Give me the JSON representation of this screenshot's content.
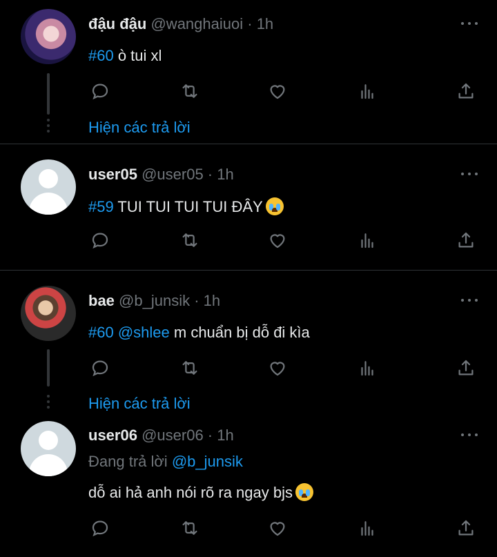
{
  "tweets": [
    {
      "name": "đậu đậu",
      "handle": "@wanghaiuoi",
      "time": "1h",
      "tag": "#60",
      "text": " ò tui xl",
      "show_replies": "Hiện các trả lời"
    },
    {
      "name": "user05",
      "handle": "@user05",
      "time": "1h",
      "tag": "#59",
      "text": " TUI TUI TUI TUI ĐÂY"
    },
    {
      "name": "bae",
      "handle": "@b_junsik",
      "time": "1h",
      "tag": "#60",
      "mention": " @shlee",
      "text": " m chuẩn bị dỗ đi kìa",
      "show_replies": "Hiện các trả lời"
    },
    {
      "name": "user06",
      "handle": "@user06",
      "time": "1h",
      "reply_prefix": "Đang trả lời ",
      "reply_to": "@b_junsik",
      "text": "dỗ ai hả anh nói rõ ra ngay bjs"
    }
  ],
  "separator": " · ",
  "icons": [
    "reply-icon",
    "retweet-icon",
    "like-icon",
    "analytics-icon",
    "share-icon",
    "more-icon",
    "crying-emoji"
  ],
  "colors": {
    "background": "#000000",
    "link": "#1d9bf0",
    "muted": "#71767b",
    "text": "#e7e9ea"
  }
}
